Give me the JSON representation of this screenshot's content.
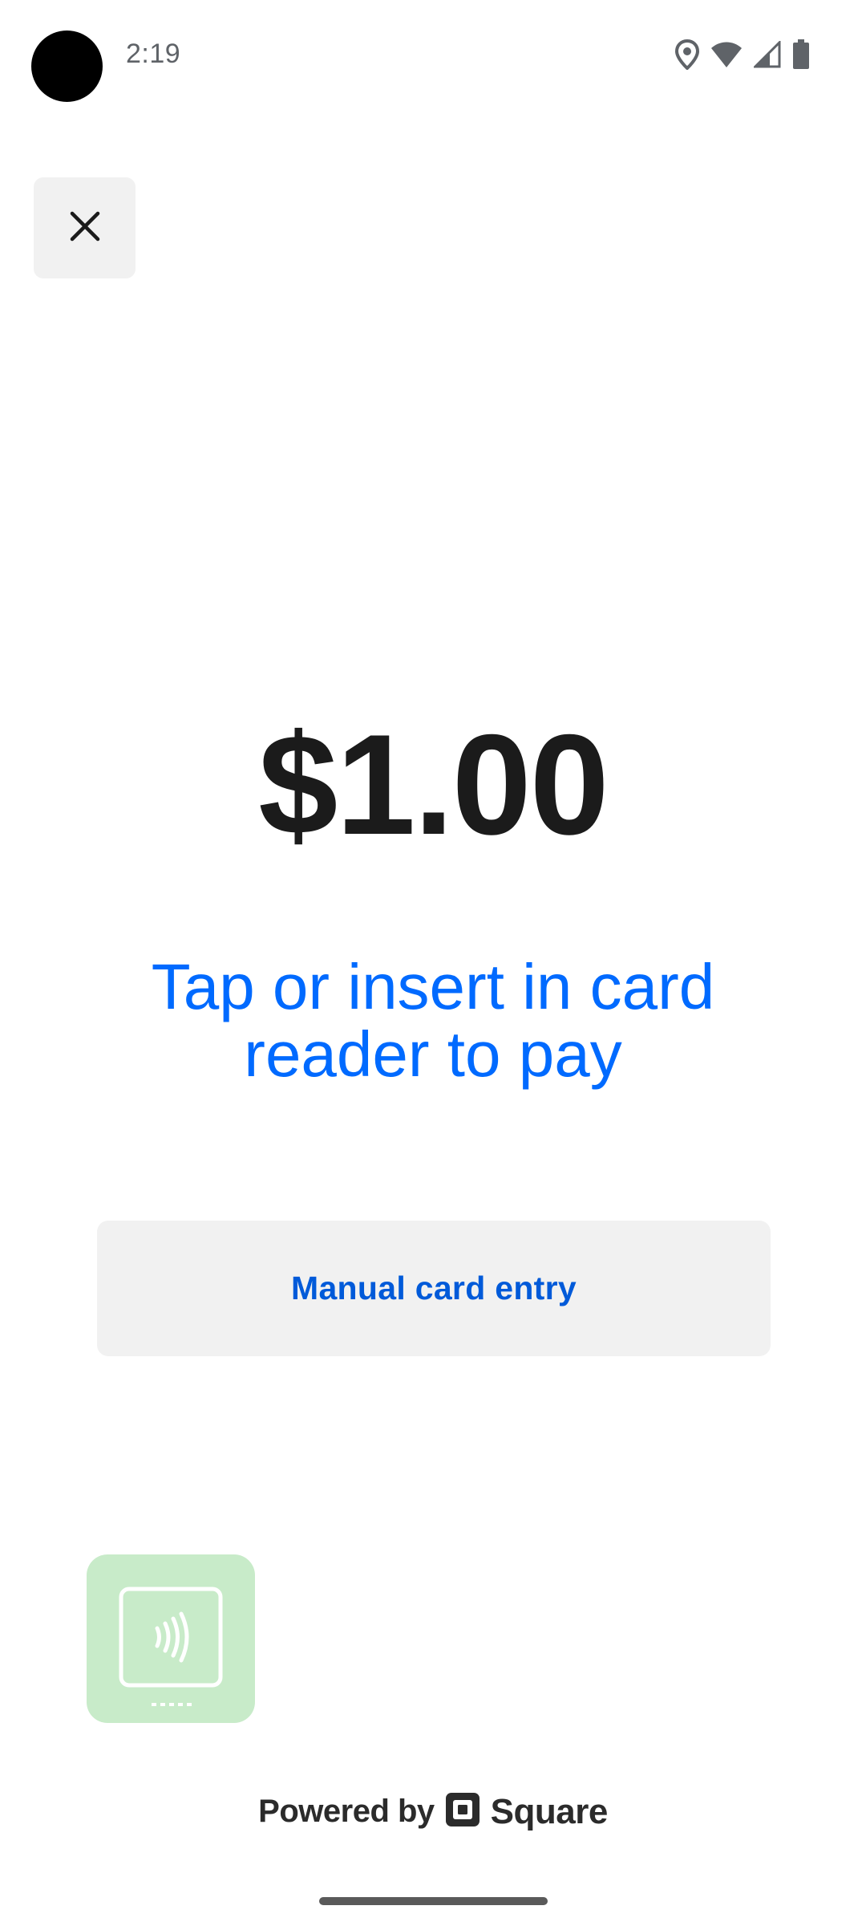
{
  "status_bar": {
    "time": "2:19",
    "icons": [
      "location-icon",
      "wifi-icon",
      "cellular-signal-icon",
      "battery-icon"
    ]
  },
  "header": {
    "close_icon": "close-icon"
  },
  "payment": {
    "amount": "$1.00",
    "instruction_line1": "Tap or insert in card",
    "instruction_line2": "reader to pay",
    "manual_entry_label": "Manual card entry"
  },
  "reader": {
    "icon": "contactless-reader-icon"
  },
  "footer": {
    "powered_by": "Powered by",
    "brand_name": "Square",
    "brand_icon": "square-logo-icon"
  },
  "colors": {
    "accent_blue": "#006aff",
    "button_text_blue": "#005ad9",
    "button_bg": "#f1f1f1",
    "amount_text": "#1b1b1b",
    "reader_tile_bg": "#c8ebc9"
  }
}
